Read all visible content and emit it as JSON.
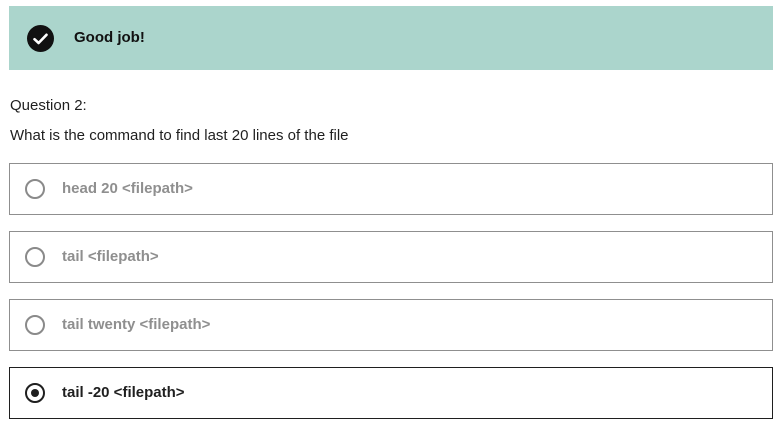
{
  "feedback": {
    "icon": "checkmark-icon",
    "message": "Good job!",
    "background_color": "#abd5cc"
  },
  "question": {
    "label": "Question 2:",
    "text": "What is the command to find last 20 lines of the file"
  },
  "options": [
    {
      "label": "head 20 <filepath>",
      "selected": false
    },
    {
      "label": "tail <filepath>",
      "selected": false
    },
    {
      "label": "tail twenty <filepath>",
      "selected": false
    },
    {
      "label": "tail -20 <filepath>",
      "selected": true
    }
  ]
}
